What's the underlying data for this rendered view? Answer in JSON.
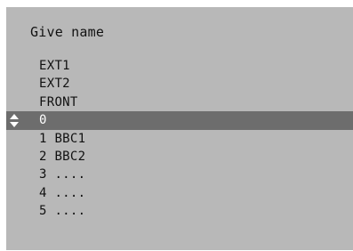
{
  "menu": {
    "title": "Give name",
    "selected_index": 3,
    "items": [
      "EXT1",
      "EXT2",
      "FRONT",
      "0",
      "1 BBC1",
      "2 BBC2",
      "3 ....",
      "4 ....",
      "5 ...."
    ]
  },
  "icons": {
    "selection_marker": "up-down-arrow-icon"
  },
  "colors": {
    "panel_background": "#b8b8b8",
    "selection_background": "#6d6d6d",
    "text": "#111111",
    "selected_text": "#ffffff"
  }
}
